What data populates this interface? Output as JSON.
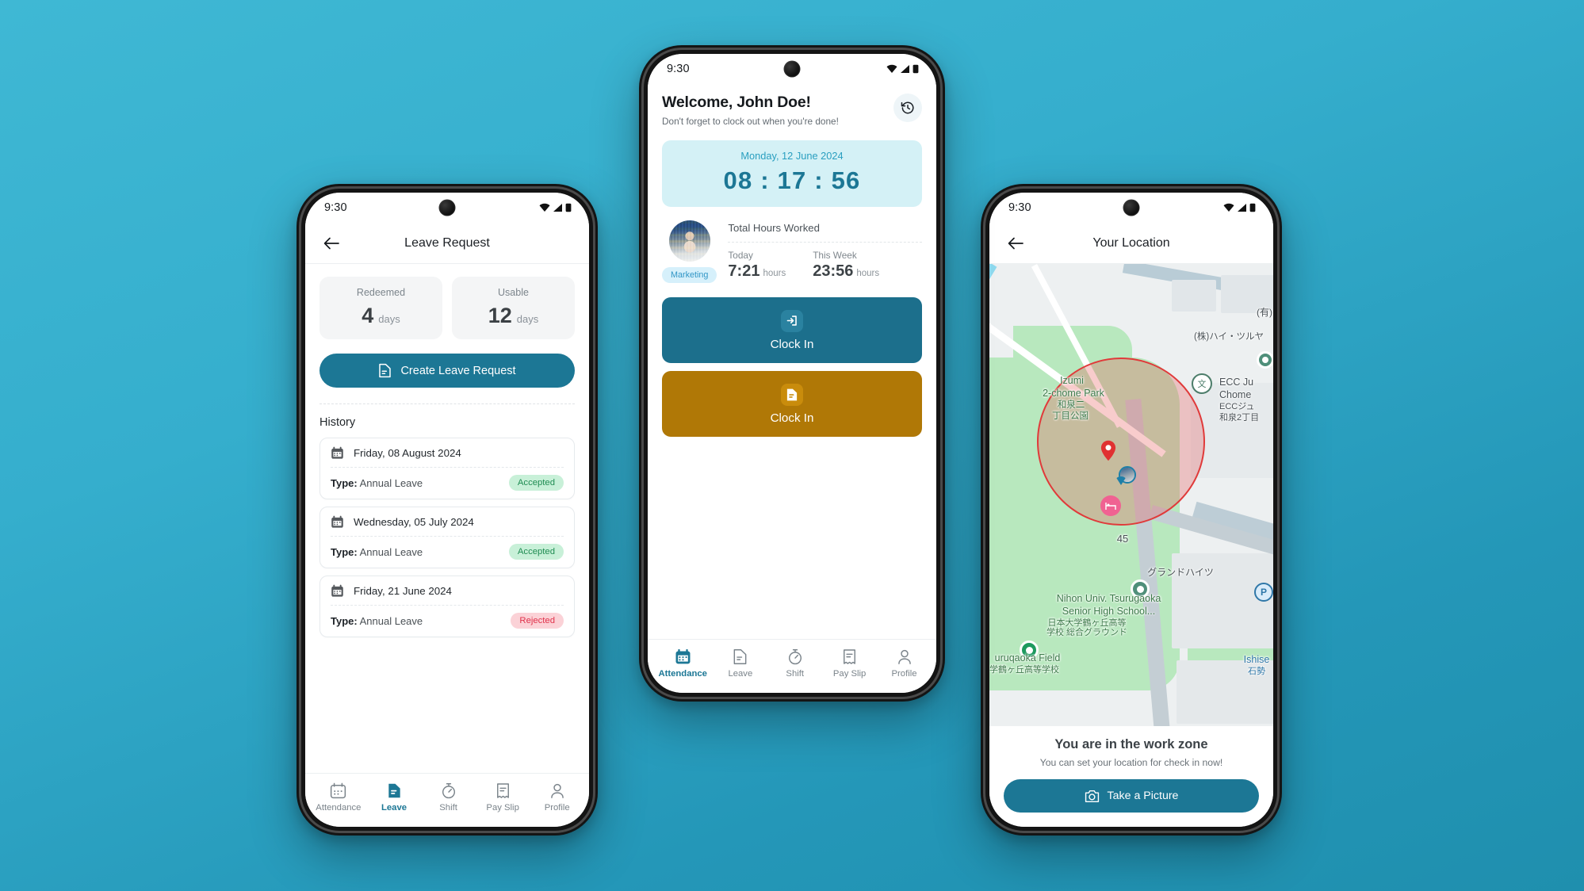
{
  "background": {
    "color_top": "#3fb8d4",
    "color_bottom": "#1f8fae"
  },
  "accent": {
    "teal": "#1c7795",
    "amber": "#b07806",
    "cyan": "#2a9fc0",
    "green": "#1f8c52",
    "red": "#e0324b"
  },
  "status_bar": {
    "time": "9:30",
    "icons": [
      "wifi-icon",
      "signal-icon",
      "battery-icon"
    ]
  },
  "nav": {
    "items": [
      {
        "label": "Attendance",
        "icon": "calendar-icon"
      },
      {
        "label": "Leave",
        "icon": "document-icon"
      },
      {
        "label": "Shift",
        "icon": "stopwatch-icon"
      },
      {
        "label": "Pay Slip",
        "icon": "receipt-icon"
      },
      {
        "label": "Profile",
        "icon": "person-icon"
      }
    ]
  },
  "leave_screen": {
    "title": "Leave Request",
    "back_icon": "arrow-left-icon",
    "active_nav": "Leave",
    "stats": [
      {
        "label": "Redeemed",
        "value": "4",
        "unit": "days"
      },
      {
        "label": "Usable",
        "value": "12",
        "unit": "days"
      }
    ],
    "create_button": {
      "label": "Create Leave Request",
      "icon": "document-icon"
    },
    "history_heading": "History",
    "history": [
      {
        "date": "Friday, 08 August 2024",
        "type_label": "Type:",
        "type_value": "Annual Leave",
        "status": "Accepted",
        "status_kind": "accepted",
        "icon": "calendar-icon"
      },
      {
        "date": "Wednesday, 05 July 2024",
        "type_label": "Type:",
        "type_value": "Annual Leave",
        "status": "Accepted",
        "status_kind": "accepted",
        "icon": "calendar-icon"
      },
      {
        "date": "Friday, 21 June 2024",
        "type_label": "Type:",
        "type_value": "Annual Leave",
        "status": "Rejected",
        "status_kind": "rejected",
        "icon": "calendar-icon"
      }
    ]
  },
  "attendance_screen": {
    "welcome_title": "Welcome, John Doe!",
    "welcome_subtitle": "Don't forget to clock out when you're done!",
    "history_icon": "history-clock-icon",
    "active_nav": "Attendance",
    "timer": {
      "date": "Monday, 12 June 2024",
      "value": "08 : 17 : 56"
    },
    "hours": {
      "title": "Total Hours Worked",
      "department": "Marketing",
      "avatar": "user-avatar",
      "columns": [
        {
          "label": "Today",
          "value": "7:21",
          "unit": "hours"
        },
        {
          "label": "This Week",
          "value": "23:56",
          "unit": "hours"
        }
      ]
    },
    "buttons": [
      {
        "label": "Clock In",
        "icon": "login-arrow-icon",
        "kind": "in"
      },
      {
        "label": "Clock In",
        "icon": "document-icon",
        "kind": "out"
      }
    ]
  },
  "location_screen": {
    "title": "Your Location",
    "back_icon": "arrow-left-icon",
    "zone_title": "You are in the work zone",
    "zone_subtitle": "You can set your location for check in now!",
    "take_picture_button": {
      "label": "Take a Picture",
      "icon": "camera-icon"
    },
    "map_labels": [
      {
        "text": "Izumi",
        "kind": "park"
      },
      {
        "text": "2-chome Park",
        "kind": "park"
      },
      {
        "text": "和泉二",
        "kind": "park"
      },
      {
        "text": "丁目公園",
        "kind": "park"
      },
      {
        "text": "(有)",
        "kind": "dark"
      },
      {
        "text": "(株)ハイ・ツルヤ",
        "kind": "dark"
      },
      {
        "text": "ECC Ju",
        "kind": "dark"
      },
      {
        "text": "Chome",
        "kind": "dark"
      },
      {
        "text": "ECCジュ",
        "kind": "dark"
      },
      {
        "text": "和泉2丁目",
        "kind": "dark"
      },
      {
        "text": "45",
        "kind": "dark"
      },
      {
        "text": "グランドハイツ",
        "kind": "dark"
      },
      {
        "text": "Nihon Univ. Tsurugaoka",
        "kind": "park"
      },
      {
        "text": "Senior High School...",
        "kind": "park"
      },
      {
        "text": "日本大学鶴ヶ丘高等",
        "kind": "park"
      },
      {
        "text": "学校 総合グラウンド",
        "kind": "park"
      },
      {
        "text": "uruqaoka Field",
        "kind": "park"
      },
      {
        "text": "学鶴ヶ丘高等学校",
        "kind": "park"
      },
      {
        "text": "Ishise",
        "kind": "blue"
      },
      {
        "text": "石勢",
        "kind": "blue"
      },
      {
        "text": "P",
        "kind": "blue"
      }
    ]
  }
}
